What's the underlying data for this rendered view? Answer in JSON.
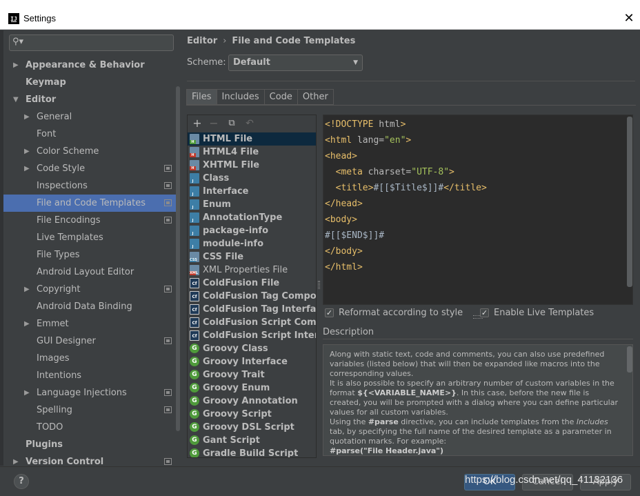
{
  "window": {
    "title": "Settings",
    "app_icon": "IJ"
  },
  "search": {
    "value": "",
    "icon": "search-icon"
  },
  "sidebar": {
    "items": [
      {
        "label": "Appearance & Behavior",
        "level": 0,
        "expandable": true,
        "expanded": false,
        "bold": true,
        "project_icon": false
      },
      {
        "label": "Keymap",
        "level": 0,
        "expandable": false,
        "bold": true,
        "project_icon": false
      },
      {
        "label": "Editor",
        "level": 0,
        "expandable": true,
        "expanded": true,
        "bold": true,
        "project_icon": false
      },
      {
        "label": "General",
        "level": 1,
        "expandable": true,
        "expanded": false,
        "bold": false,
        "project_icon": false
      },
      {
        "label": "Font",
        "level": 1,
        "expandable": false,
        "bold": false,
        "project_icon": false
      },
      {
        "label": "Color Scheme",
        "level": 1,
        "expandable": true,
        "expanded": false,
        "bold": false,
        "project_icon": false
      },
      {
        "label": "Code Style",
        "level": 1,
        "expandable": true,
        "expanded": false,
        "bold": false,
        "project_icon": true
      },
      {
        "label": "Inspections",
        "level": 1,
        "expandable": false,
        "bold": false,
        "project_icon": true
      },
      {
        "label": "File and Code Templates",
        "level": 1,
        "expandable": false,
        "bold": false,
        "project_icon": true,
        "selected": true
      },
      {
        "label": "File Encodings",
        "level": 1,
        "expandable": false,
        "bold": false,
        "project_icon": true
      },
      {
        "label": "Live Templates",
        "level": 1,
        "expandable": false,
        "bold": false,
        "project_icon": false
      },
      {
        "label": "File Types",
        "level": 1,
        "expandable": false,
        "bold": false,
        "project_icon": false
      },
      {
        "label": "Android Layout Editor",
        "level": 1,
        "expandable": false,
        "bold": false,
        "project_icon": false
      },
      {
        "label": "Copyright",
        "level": 1,
        "expandable": true,
        "expanded": false,
        "bold": false,
        "project_icon": true
      },
      {
        "label": "Android Data Binding",
        "level": 1,
        "expandable": false,
        "bold": false,
        "project_icon": false
      },
      {
        "label": "Emmet",
        "level": 1,
        "expandable": true,
        "expanded": false,
        "bold": false,
        "project_icon": false
      },
      {
        "label": "GUI Designer",
        "level": 1,
        "expandable": false,
        "bold": false,
        "project_icon": true
      },
      {
        "label": "Images",
        "level": 1,
        "expandable": false,
        "bold": false,
        "project_icon": false
      },
      {
        "label": "Intentions",
        "level": 1,
        "expandable": false,
        "bold": false,
        "project_icon": false
      },
      {
        "label": "Language Injections",
        "level": 1,
        "expandable": true,
        "expanded": false,
        "bold": false,
        "project_icon": true
      },
      {
        "label": "Spelling",
        "level": 1,
        "expandable": false,
        "bold": false,
        "project_icon": true
      },
      {
        "label": "TODO",
        "level": 1,
        "expandable": false,
        "bold": false,
        "project_icon": false
      },
      {
        "label": "Plugins",
        "level": 0,
        "expandable": false,
        "bold": true,
        "project_icon": false
      },
      {
        "label": "Version Control",
        "level": 0,
        "expandable": true,
        "expanded": false,
        "bold": true,
        "project_icon": true
      }
    ]
  },
  "breadcrumb": {
    "parent": "Editor",
    "separator": "›",
    "current": "File and Code Templates"
  },
  "scheme": {
    "label": "Scheme:",
    "value": "Default"
  },
  "tabs": [
    {
      "label": "Files",
      "active": true
    },
    {
      "label": "Includes",
      "active": false
    },
    {
      "label": "Code",
      "active": false
    },
    {
      "label": "Other",
      "active": false
    }
  ],
  "templates": [
    {
      "name": "HTML File",
      "icon": "html-file-icon",
      "kind": "doc",
      "badge": "H",
      "badge_color": "#4f9a3b",
      "bold": true,
      "selected": true
    },
    {
      "name": "HTML4 File",
      "icon": "html4-file-icon",
      "kind": "doc",
      "badge": "H",
      "badge_color": "#c0392b",
      "bold": true
    },
    {
      "name": "XHTML File",
      "icon": "xhtml-file-icon",
      "kind": "doc",
      "badge": "H",
      "badge_color": "#c0392b",
      "bold": true
    },
    {
      "name": "Class",
      "icon": "java-class-file-icon",
      "kind": "cls",
      "badge": "J",
      "badge_color": "#3d7ea6",
      "bold": true
    },
    {
      "name": "Interface",
      "icon": "java-interface-file-icon",
      "kind": "cls",
      "badge": "J",
      "badge_color": "#3d7ea6",
      "bold": true
    },
    {
      "name": "Enum",
      "icon": "java-enum-file-icon",
      "kind": "cls",
      "badge": "J",
      "badge_color": "#3d7ea6",
      "bold": true
    },
    {
      "name": "AnnotationType",
      "icon": "java-annotation-file-icon",
      "kind": "cls",
      "badge": "J",
      "badge_color": "#3d7ea6",
      "bold": true
    },
    {
      "name": "package-info",
      "icon": "java-package-info-file-icon",
      "kind": "cls",
      "badge": "J",
      "badge_color": "#3d7ea6",
      "bold": true
    },
    {
      "name": "module-info",
      "icon": "java-module-info-file-icon",
      "kind": "cls",
      "badge": "J",
      "badge_color": "#3d7ea6",
      "bold": true
    },
    {
      "name": "CSS File",
      "icon": "css-file-icon",
      "kind": "doc",
      "badge": "CSS",
      "badge_color": "#3d7ea6",
      "bold": true
    },
    {
      "name": "XML Properties File",
      "icon": "xml-properties-file-icon",
      "kind": "doc",
      "badge": "XML",
      "badge_color": "#c0392b",
      "bold": false
    },
    {
      "name": "ColdFusion File",
      "icon": "coldfusion-file-icon",
      "kind": "cf",
      "badge": "Cf",
      "bold": true
    },
    {
      "name": "ColdFusion Tag Componer",
      "icon": "coldfusion-tag-component-icon",
      "kind": "cf",
      "badge": "Cf",
      "bold": true
    },
    {
      "name": "ColdFusion Tag Interface",
      "icon": "coldfusion-tag-interface-icon",
      "kind": "cf",
      "badge": "Cf",
      "bold": true
    },
    {
      "name": "ColdFusion Script Compon",
      "icon": "coldfusion-script-component-icon",
      "kind": "cf",
      "badge": "Cf",
      "bold": true
    },
    {
      "name": "ColdFusion Script Interface",
      "icon": "coldfusion-script-interface-icon",
      "kind": "cf",
      "badge": "Cf",
      "bold": true
    },
    {
      "name": "Groovy Class",
      "icon": "groovy-class-icon",
      "kind": "groovy",
      "badge": "G",
      "bold": true
    },
    {
      "name": "Groovy Interface",
      "icon": "groovy-interface-icon",
      "kind": "groovy",
      "badge": "G",
      "bold": true
    },
    {
      "name": "Groovy Trait",
      "icon": "groovy-trait-icon",
      "kind": "groovy",
      "badge": "G",
      "bold": true
    },
    {
      "name": "Groovy Enum",
      "icon": "groovy-enum-icon",
      "kind": "groovy",
      "badge": "G",
      "bold": true
    },
    {
      "name": "Groovy Annotation",
      "icon": "groovy-annotation-icon",
      "kind": "groovy",
      "badge": "G",
      "bold": true
    },
    {
      "name": "Groovy Script",
      "icon": "groovy-script-icon",
      "kind": "groovy",
      "badge": "G",
      "bold": true
    },
    {
      "name": "Groovy DSL Script",
      "icon": "groovy-dsl-script-icon",
      "kind": "groovy",
      "badge": "G",
      "bold": true
    },
    {
      "name": "Gant Script",
      "icon": "gant-script-icon",
      "kind": "groovy",
      "badge": "G",
      "bold": true
    },
    {
      "name": "Gradle Build Script",
      "icon": "gradle-build-script-icon",
      "kind": "groovy",
      "badge": "G",
      "bold": true
    }
  ],
  "toolbar": {
    "add": "+",
    "remove": "−",
    "copy": "⧉",
    "reset": "↶"
  },
  "editor": {
    "lines": [
      [
        {
          "c": "tag",
          "t": "<!DOCTYPE "
        },
        {
          "c": "attr",
          "t": "html"
        },
        {
          "c": "tag",
          "t": ">"
        }
      ],
      [
        {
          "c": "tag",
          "t": "<html "
        },
        {
          "c": "attr",
          "t": "lang="
        },
        {
          "c": "val",
          "t": "\"en\""
        },
        {
          "c": "tag",
          "t": ">"
        }
      ],
      [
        {
          "c": "tag",
          "t": "<head>"
        }
      ],
      [
        {
          "c": "txt",
          "t": "  "
        },
        {
          "c": "tag",
          "t": "<meta "
        },
        {
          "c": "attr",
          "t": "charset="
        },
        {
          "c": "val",
          "t": "\"UTF-8\""
        },
        {
          "c": "tag",
          "t": ">"
        }
      ],
      [
        {
          "c": "txt",
          "t": "  "
        },
        {
          "c": "tag",
          "t": "<title>"
        },
        {
          "c": "txt",
          "t": "#[[$Title$]]#"
        },
        {
          "c": "tag",
          "t": "</title>"
        }
      ],
      [
        {
          "c": "tag",
          "t": "</head>"
        }
      ],
      [
        {
          "c": "tag",
          "t": "<body>"
        }
      ],
      [
        {
          "c": "txt",
          "t": "#[[$END$]]#"
        }
      ],
      [
        {
          "c": "tag",
          "t": "</body>"
        }
      ],
      [
        {
          "c": "tag",
          "t": "</html>"
        }
      ]
    ]
  },
  "options": {
    "reformat": {
      "label": "Reformat according to style",
      "checked": true
    },
    "live_templates": {
      "label": "Enable Live Templates",
      "checked": true
    }
  },
  "description": {
    "title": "Description",
    "p1": "Along with static text, code and comments, you can also use predefined variables (listed below) that will then be expanded like macros into the corresponding values.",
    "p2a": "It is also possible to specify an arbitrary number of custom variables in the format ",
    "p2b": "${<VARIABLE_NAME>}",
    "p2c": ". In this case, before the new file is created, you will be prompted with a dialog where you can define particular values for all custom variables.",
    "p3a": "Using the ",
    "p3b": "#parse",
    "p3c": " directive, you can include templates from the ",
    "p3d": "Includes",
    "p3e": " tab, by specifying the full name of the desired template as a parameter in quotation marks. For example:",
    "p4": "#parse(\"File Header.java\")"
  },
  "footer": {
    "help": "?",
    "ok": "OK",
    "cancel": "Cancel",
    "apply": "Apply",
    "watermark": "https://blog.csdn.net/qq_41132136"
  },
  "colors": {
    "accent": "#4b6eaf",
    "panel": "#3c3f41",
    "editor_bg": "#2b2b2b",
    "selected_row": "#0d293e",
    "ok_button": "#365880"
  }
}
